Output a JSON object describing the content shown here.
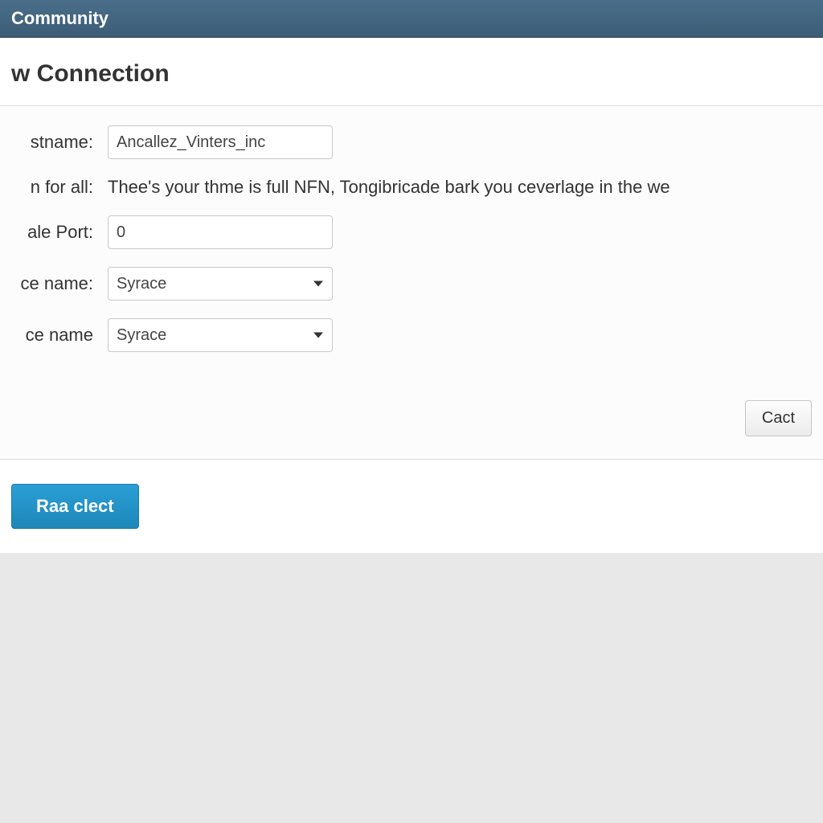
{
  "topbar": {
    "title": "Community"
  },
  "page": {
    "title": "w Connection"
  },
  "form": {
    "hostname": {
      "label": "stname:",
      "value": "Ancallez_Vinters_inc"
    },
    "description": {
      "label": "n for all:",
      "text": "Thee's your thme is full NFN, Tongibricade bark you ceverlage in the we"
    },
    "port": {
      "label": "ale Port:",
      "value": "0"
    },
    "service1": {
      "label": "ce name:",
      "selected": "Syrace"
    },
    "service2": {
      "label": "ce name",
      "selected": "Syrace"
    }
  },
  "actions": {
    "cancel": "Cact",
    "primary": "Raa clect"
  }
}
